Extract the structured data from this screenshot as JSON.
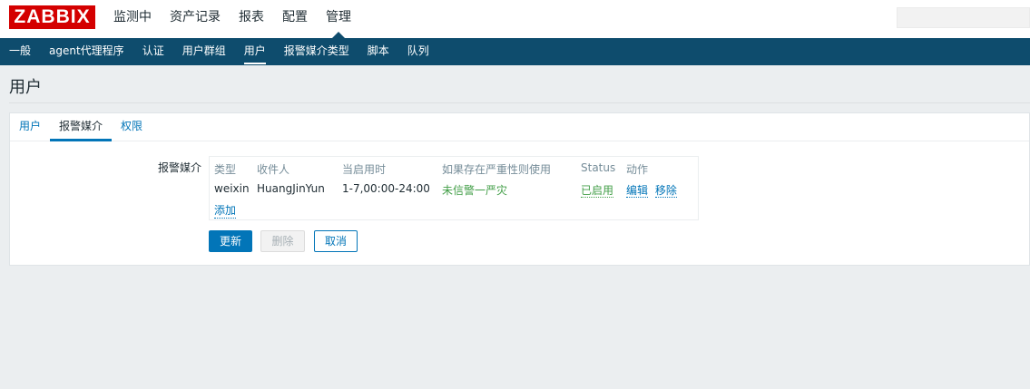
{
  "header": {
    "logo": "ZABBIX",
    "menu": [
      "监测中",
      "资产记录",
      "报表",
      "配置",
      "管理"
    ],
    "active_menu": "管理"
  },
  "subnav": {
    "items": [
      "一般",
      "agent代理程序",
      "认证",
      "用户群组",
      "用户",
      "报警媒介类型",
      "脚本",
      "队列"
    ],
    "active": "用户"
  },
  "page": {
    "title": "用户"
  },
  "tabs": [
    "用户",
    "报警媒介",
    "权限"
  ],
  "active_tab": "报警媒介",
  "media": {
    "label": "报警媒介",
    "columns": [
      "类型",
      "收件人",
      "当启用时",
      "如果存在严重性则使用",
      "Status",
      "动作"
    ],
    "rows": [
      {
        "type": "weixin",
        "recipient": "HuangJinYun",
        "when_active": "1-7,00:00-24:00",
        "severity": "未信警一严灾",
        "status": "已启用",
        "actions": [
          "编辑",
          "移除"
        ]
      }
    ],
    "add_label": "添加"
  },
  "buttons": {
    "update": "更新",
    "delete": "删除",
    "cancel": "取消"
  },
  "colors": {
    "brand": "#d40000",
    "nav_bg": "#0e4c6d",
    "link": "#0275b8",
    "status_green": "#429e47"
  }
}
